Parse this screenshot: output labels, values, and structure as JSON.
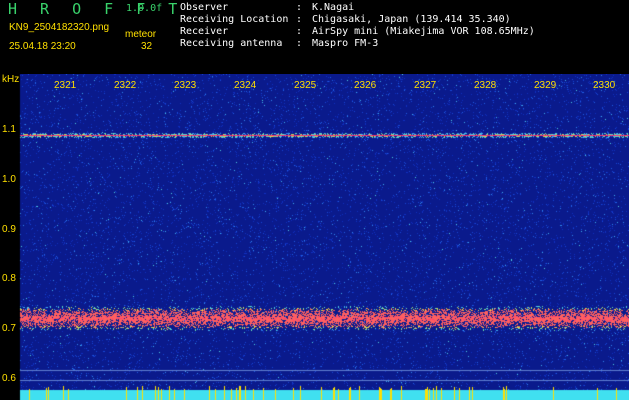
{
  "header": {
    "app_title": "H R O F F T",
    "version": "1.0.0f",
    "filename": "KN9_2504182320.png",
    "mode": "meteor",
    "datetime": "25.04.18 23:20",
    "count": "32",
    "info": [
      {
        "label": "Observer",
        "value": "K.Nagai"
      },
      {
        "label": "Receiving Location",
        "value": "Chigasaki, Japan (139.414 35.340)"
      },
      {
        "label": "Receiver",
        "value": "AirSpy mini (Miakejima VOR 108.65MHz)"
      },
      {
        "label": "Receiving antenna",
        "value": "Maspro FM-3"
      }
    ]
  },
  "axis": {
    "unit": "kHz",
    "time_ticks": [
      "2321",
      "2322",
      "2323",
      "2324",
      "2325",
      "2326",
      "2327",
      "2328",
      "2329",
      "2330"
    ],
    "freq_ticks": [
      "1.1",
      "1.0",
      "0.9",
      "0.8",
      "0.7",
      "0.6"
    ]
  },
  "colors": {
    "background": "#0a1a8c",
    "label": "#ffe000",
    "carrier": "#ff3070"
  }
}
